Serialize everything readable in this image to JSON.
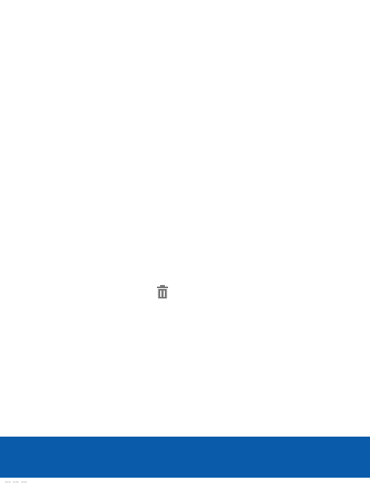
{
  "content": {
    "icon": "trash-can-icon"
  },
  "colors": {
    "background": "#ffffff",
    "bottom_bar": "#0a5cab",
    "icon": "#777777"
  },
  "footer": {
    "partial_text": "… … …"
  }
}
